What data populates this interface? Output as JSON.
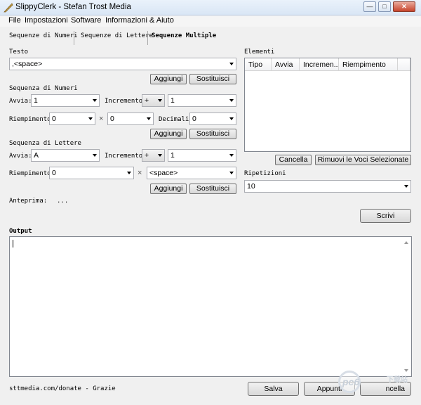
{
  "window": {
    "title": "SlippyClerk - Stefan Trost Media"
  },
  "menu": [
    "File",
    "Impostazioni",
    "Software",
    "Informazioni & Aiuto"
  ],
  "tabs": [
    "Sequenze di Numeri",
    "Sequenze di Lettere",
    "Sequenze Multiple"
  ],
  "testo": {
    "label": "Testo",
    "value": ",<space>",
    "add": "Aggiungi",
    "replace": "Sostituisci"
  },
  "numeri": {
    "heading": "Sequenza di Numeri",
    "avvia_label": "Avvia:",
    "avvia_value": "1",
    "incremento_label": "Incremento:",
    "op": "+",
    "incremento_value": "1",
    "riempimento_label": "Riempimento:",
    "fill_a": "0",
    "times": "×",
    "fill_b": "0",
    "decimali_label": "Decimali:",
    "decimali_value": "0",
    "add": "Aggiungi",
    "replace": "Sostituisci"
  },
  "lettere": {
    "heading": "Sequenza di Lettere",
    "avvia_label": "Avvia:",
    "avvia_value": "A",
    "incremento_label": "Incremento:",
    "op": "+",
    "incremento_value": "1",
    "riempimento_label": "Riempimento:",
    "fill_a": "0",
    "times": "×",
    "fill_b": "<space>",
    "add": "Aggiungi",
    "replace": "Sostituisci"
  },
  "anteprima": {
    "label": "Anteprima:",
    "value": "..."
  },
  "elementi": {
    "label": "Elementi",
    "columns": [
      "Tipo",
      "Avvia",
      "Incremen...",
      "Riempimento"
    ],
    "cancel": "Cancella",
    "remove": "Rimuovi le Voci Selezionate"
  },
  "ripetizioni": {
    "label": "Ripetizioni",
    "value": "10"
  },
  "scrivi": "Scrivi",
  "output": {
    "label": "Output"
  },
  "footer": {
    "link": "sttmedia.com/donate - Grazie",
    "save": "Salva",
    "append": "Appunti",
    "clear": "ncella"
  },
  "watermark": {
    "logo": "pc6",
    "text": "下载站"
  }
}
